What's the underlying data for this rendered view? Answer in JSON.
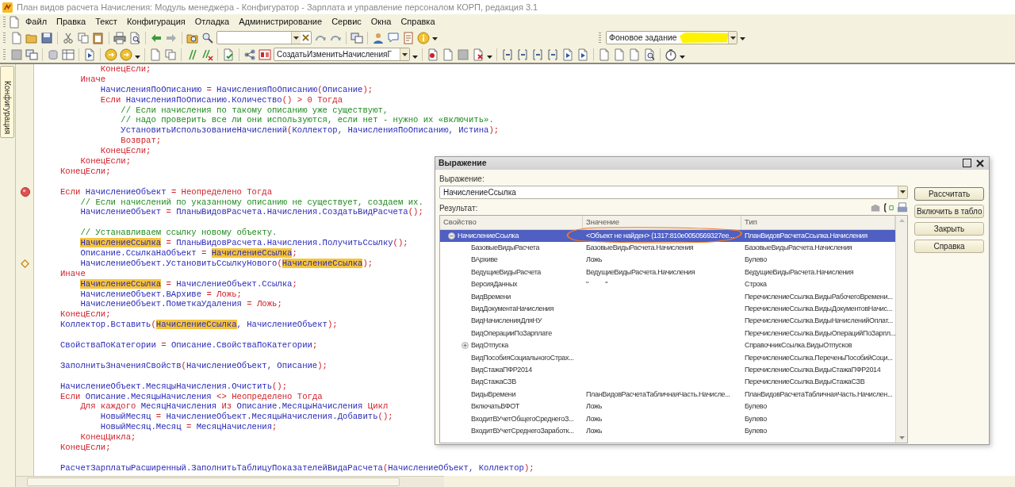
{
  "window": {
    "title": "План видов расчета Начисления: Модуль менеджера - Конфигуратор - Зарплата и управление персоналом КОРП, редакция 3.1"
  },
  "menu": [
    "Файл",
    "Правка",
    "Текст",
    "Конфигурация",
    "Отладка",
    "Администрирование",
    "Сервис",
    "Окна",
    "Справка"
  ],
  "toolbar": {
    "module_selector": "СоздатьИзменитьНачисленияГ",
    "background_job": "Фоновое задание"
  },
  "side_panel": {
    "tabs": [
      {
        "label": "Конфигурация",
        "selected": true
      }
    ]
  },
  "code": {
    "lines": [
      {
        "kind": "code",
        "segments": [
          {
            "kind": "keyword",
            "text": "        КонецЕсли;"
          }
        ]
      },
      {
        "kind": "code",
        "segments": [
          {
            "kind": "keyword",
            "text": "    Иначе"
          }
        ]
      },
      {
        "kind": "code",
        "segments": [
          {
            "kind": "name",
            "text": "        НачисленияПоОписанию"
          },
          {
            "kind": "keyword",
            "text": " = "
          },
          {
            "kind": "name",
            "text": "НачисленияПоОписанию"
          },
          {
            "kind": "keyword",
            "text": "("
          },
          {
            "kind": "name",
            "text": "Описание"
          },
          {
            "kind": "keyword",
            "text": ");"
          }
        ]
      },
      {
        "kind": "code",
        "segments": [
          {
            "kind": "keyword",
            "text": "        Если "
          },
          {
            "kind": "name",
            "text": "НачисленияПоОписанию.Количество"
          },
          {
            "kind": "keyword",
            "text": "() > 0 Тогда"
          }
        ]
      },
      {
        "kind": "code",
        "segments": [
          {
            "kind": "comment",
            "text": "            // Если начисления по такому описанию уже существуют,"
          }
        ]
      },
      {
        "kind": "code",
        "segments": [
          {
            "kind": "comment",
            "text": "            // надо проверить все ли они используются, если нет - нужно их «включить»."
          }
        ]
      },
      {
        "kind": "code",
        "segments": [
          {
            "kind": "name",
            "text": "            УстановитьИспользованиеНачислений"
          },
          {
            "kind": "keyword",
            "text": "("
          },
          {
            "kind": "name",
            "text": "Коллектор, НачисленияПоОписанию, Истина"
          },
          {
            "kind": "keyword",
            "text": ");"
          }
        ]
      },
      {
        "kind": "code",
        "segments": [
          {
            "kind": "keyword",
            "text": "            Возврат;"
          }
        ]
      },
      {
        "kind": "code",
        "segments": [
          {
            "kind": "keyword",
            "text": "        КонецЕсли;"
          }
        ]
      },
      {
        "kind": "code",
        "segments": [
          {
            "kind": "keyword",
            "text": "    КонецЕсли;"
          }
        ]
      },
      {
        "kind": "code",
        "segments": [
          {
            "kind": "keyword",
            "text": "КонецЕсли;"
          }
        ]
      },
      {
        "kind": "blank"
      },
      {
        "kind": "code",
        "breakpoint": true,
        "segments": [
          {
            "kind": "keyword",
            "text": "Если "
          },
          {
            "kind": "name",
            "text": "НачислениеОбъект"
          },
          {
            "kind": "keyword",
            "text": " = Неопределено Тогда"
          }
        ]
      },
      {
        "kind": "code",
        "segments": [
          {
            "kind": "comment",
            "text": "    // Если начислений по указанному описанию не существует, создаем их."
          }
        ]
      },
      {
        "kind": "code",
        "segments": [
          {
            "kind": "name",
            "text": "    НачислениеОбъект"
          },
          {
            "kind": "keyword",
            "text": " = "
          },
          {
            "kind": "name",
            "text": "ПланыВидовРасчета.Начисления.СоздатьВидРасчета"
          },
          {
            "kind": "keyword",
            "text": "();"
          }
        ]
      },
      {
        "kind": "blank"
      },
      {
        "kind": "code",
        "segments": [
          {
            "kind": "comment",
            "text": "    // Устанавливаем ссылку новому объекту."
          }
        ]
      },
      {
        "kind": "code",
        "segments": [
          {
            "kind": "found",
            "text": "    НачислениеСсылка"
          },
          {
            "kind": "keyword",
            "text": " = "
          },
          {
            "kind": "name",
            "text": "ПланыВидовРасчета.Начисления.ПолучитьСсылку"
          },
          {
            "kind": "keyword",
            "text": "();"
          }
        ]
      },
      {
        "kind": "code",
        "segments": [
          {
            "kind": "name",
            "text": "    Описание.СсылкаНаОбъект"
          },
          {
            "kind": "keyword",
            "text": " = "
          },
          {
            "kind": "found",
            "text": "НачислениеСсылка"
          },
          {
            "kind": "keyword",
            "text": ";"
          }
        ]
      },
      {
        "kind": "code",
        "current": true,
        "segments": [
          {
            "kind": "name",
            "text": "    НачислениеОбъект.УстановитьСсылкуНового"
          },
          {
            "kind": "keyword",
            "text": "("
          },
          {
            "kind": "found",
            "text": "НачислениеСсылка"
          },
          {
            "kind": "keyword",
            "text": ");"
          }
        ]
      },
      {
        "kind": "code",
        "segments": [
          {
            "kind": "keyword",
            "text": "Иначе"
          }
        ]
      },
      {
        "kind": "code",
        "segments": [
          {
            "kind": "found",
            "text": "    НачислениеСсылка"
          },
          {
            "kind": "keyword",
            "text": " = "
          },
          {
            "kind": "name",
            "text": "НачислениеОбъект.Ссылка"
          },
          {
            "kind": "keyword",
            "text": ";"
          }
        ]
      },
      {
        "kind": "code",
        "segments": [
          {
            "kind": "name",
            "text": "    НачислениеОбъект.ВАрхиве"
          },
          {
            "kind": "keyword",
            "text": " = Ложь;"
          }
        ]
      },
      {
        "kind": "code",
        "segments": [
          {
            "kind": "name",
            "text": "    НачислениеОбъект.ПометкаУдаления"
          },
          {
            "kind": "keyword",
            "text": " = Ложь;"
          }
        ]
      },
      {
        "kind": "code",
        "segments": [
          {
            "kind": "keyword",
            "text": "КонецЕсли;"
          }
        ]
      },
      {
        "kind": "code",
        "segments": [
          {
            "kind": "name",
            "text": "Коллектор.Вставить"
          },
          {
            "kind": "keyword",
            "text": "("
          },
          {
            "kind": "found",
            "text": "НачислениеСсылка"
          },
          {
            "kind": "name",
            "text": ", НачислениеОбъект"
          },
          {
            "kind": "keyword",
            "text": ");"
          }
        ]
      },
      {
        "kind": "blank"
      },
      {
        "kind": "code",
        "segments": [
          {
            "kind": "name",
            "text": "СвойстваПоКатегории"
          },
          {
            "kind": "keyword",
            "text": " = "
          },
          {
            "kind": "name",
            "text": "Описание.СвойстваПоКатегории"
          },
          {
            "kind": "keyword",
            "text": ";"
          }
        ]
      },
      {
        "kind": "blank"
      },
      {
        "kind": "code",
        "segments": [
          {
            "kind": "name",
            "text": "ЗаполнитьЗначенияСвойств"
          },
          {
            "kind": "keyword",
            "text": "("
          },
          {
            "kind": "name",
            "text": "НачислениеОбъект, Описание"
          },
          {
            "kind": "keyword",
            "text": ");"
          }
        ]
      },
      {
        "kind": "blank"
      },
      {
        "kind": "code",
        "segments": [
          {
            "kind": "name",
            "text": "НачислениеОбъект.МесяцыНачисления.Очистить"
          },
          {
            "kind": "keyword",
            "text": "();"
          }
        ]
      },
      {
        "kind": "code",
        "segments": [
          {
            "kind": "keyword",
            "text": "Если "
          },
          {
            "kind": "name",
            "text": "Описание.МесяцыНачисления"
          },
          {
            "kind": "keyword",
            "text": " <> Неопределено Тогда"
          }
        ]
      },
      {
        "kind": "code",
        "segments": [
          {
            "kind": "keyword",
            "text": "    Для каждого "
          },
          {
            "kind": "name",
            "text": "МесяцНачисления"
          },
          {
            "kind": "keyword",
            "text": " Из "
          },
          {
            "kind": "name",
            "text": "Описание.МесяцыНачисления"
          },
          {
            "kind": "keyword",
            "text": " Цикл"
          }
        ]
      },
      {
        "kind": "code",
        "segments": [
          {
            "kind": "name",
            "text": "        НовыйМесяц"
          },
          {
            "kind": "keyword",
            "text": " = "
          },
          {
            "kind": "name",
            "text": "НачислениеОбъект.МесяцыНачисления.Добавить"
          },
          {
            "kind": "keyword",
            "text": "();"
          }
        ]
      },
      {
        "kind": "code",
        "segments": [
          {
            "kind": "name",
            "text": "        НовыйМесяц.Месяц"
          },
          {
            "kind": "keyword",
            "text": " = "
          },
          {
            "kind": "name",
            "text": "МесяцНачисления"
          },
          {
            "kind": "keyword",
            "text": ";"
          }
        ]
      },
      {
        "kind": "code",
        "segments": [
          {
            "kind": "keyword",
            "text": "    КонецЦикла;"
          }
        ]
      },
      {
        "kind": "code",
        "segments": [
          {
            "kind": "keyword",
            "text": "КонецЕсли;"
          }
        ]
      },
      {
        "kind": "blank"
      },
      {
        "kind": "code",
        "segments": [
          {
            "kind": "name",
            "text": "РасчетЗарплатыРасширенный.ЗаполнитьТаблицуПоказателейВидаРасчета"
          },
          {
            "kind": "keyword",
            "text": "("
          },
          {
            "kind": "name",
            "text": "НачислениеОбъект, Коллектор"
          },
          {
            "kind": "keyword",
            "text": ");"
          }
        ]
      }
    ]
  },
  "dialog": {
    "title": "Выражение",
    "expression_label": "Выражение:",
    "expression": "НачислениеСсылка",
    "result_label": "Результат:",
    "columns": [
      "Свойство",
      "Значение",
      "Тип"
    ],
    "rows": [
      {
        "property": "НачислениеСсылка",
        "value": "<Объект не найден> (1317:810e0050569327ee...",
        "type": "ПланВидовРасчетаСсылка.Начисления",
        "selected": true,
        "expanded": true,
        "children": [
          {
            "property": "БазовыеВидыРасчета",
            "value": "БазовыеВидыРасчета.Начисления",
            "type": "БазовыеВидыРасчета.Начисления",
            "selected": false
          },
          {
            "property": "ВАрхиве",
            "value": "Ложь",
            "type": "Булево",
            "selected": false
          },
          {
            "property": "ВедущиеВидыРасчета",
            "value": "ВедущиеВидыРасчета.Начисления",
            "type": "ВедущиеВидыРасчета.Начисления",
            "selected": false
          },
          {
            "property": "ВерсияДанных",
            "value": "\"          \"",
            "type": "Строка",
            "selected": false
          },
          {
            "property": "ВидВремени",
            "type": "ПеречислениеСсылка.ВидыРабочегоВремени...",
            "selected": false
          },
          {
            "property": "ВидДокументаНачисления",
            "type": "ПеречислениеСсылка.ВидыДокументовНачис...",
            "selected": false
          },
          {
            "property": "ВидНачисленияДляНУ",
            "type": "ПеречислениеСсылка.ВидыНачисленийОплат...",
            "selected": false
          },
          {
            "property": "ВидОперацииПоЗарплате",
            "type": "ПеречислениеСсылка.ВидыОперацийПоЗарпл...",
            "selected": false
          },
          {
            "property": "ВидОтпуска",
            "type": "СправочникСсылка.ВидыОтпусков",
            "selected": false,
            "expanded": false
          },
          {
            "property": "ВидПособияСоциальногоСтрах...",
            "type": "ПеречислениеСсылка.ПереченьПособийСоци...",
            "selected": false
          },
          {
            "property": "ВидСтажаПФР2014",
            "type": "ПеречислениеСсылка.ВидыСтажаПФР2014",
            "selected": false
          },
          {
            "property": "ВидСтажаСЗВ",
            "type": "ПеречислениеСсылка.ВидыСтажаСЗВ",
            "selected": false
          },
          {
            "property": "ВидыВремени",
            "value": "ПланВидовРасчетаТабличнаяЧасть.Начисле...",
            "type": "ПланВидовРасчетаТабличнаяЧасть.Начислен...",
            "selected": false
          },
          {
            "property": "ВключатьВФОТ",
            "value": "Ложь",
            "type": "Булево",
            "selected": false
          },
          {
            "property": "ВходитВУчетОбщегоСреднегоЗ...",
            "value": "Ложь",
            "type": "Булево",
            "selected": false
          },
          {
            "property": "ВходитВУчетСреднегоЗаработк...",
            "value": "Ложь",
            "type": "Булево",
            "selected": false
          }
        ]
      }
    ],
    "buttons": [
      {
        "label": "Рассчитать",
        "default": true
      },
      {
        "label": "Включить в табло",
        "default": false
      },
      {
        "label": "Закрыть",
        "default": false
      },
      {
        "label": "Справка",
        "default": false
      }
    ]
  }
}
